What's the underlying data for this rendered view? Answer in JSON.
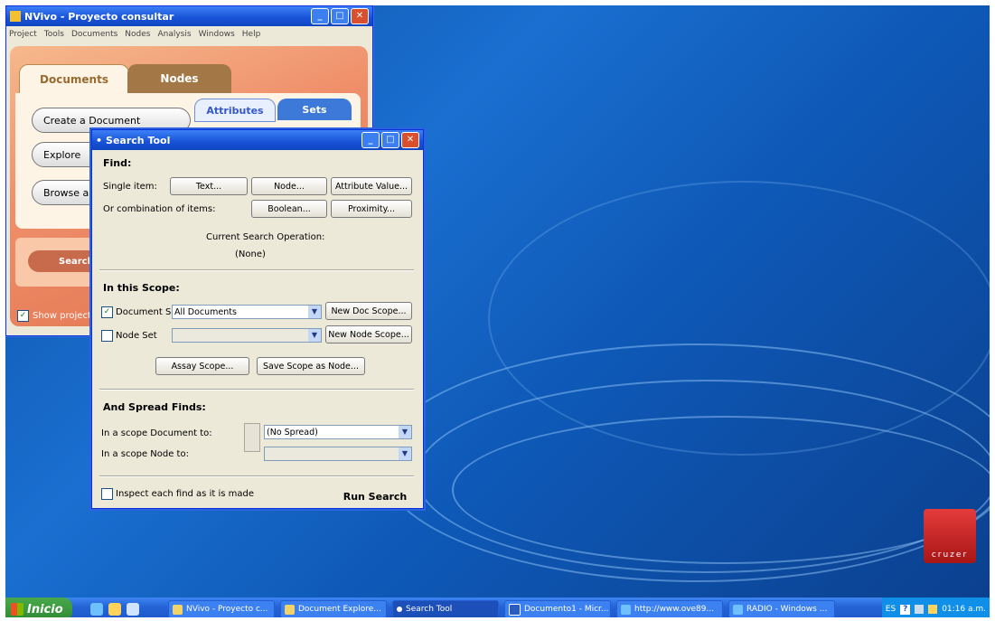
{
  "nvivo": {
    "title": "NVivo - Proyecto consultar",
    "menu": [
      "Project",
      "Tools",
      "Documents",
      "Nodes",
      "Analysis",
      "Windows",
      "Help"
    ],
    "tabs": [
      "Documents",
      "Nodes"
    ],
    "subtabs": [
      "Attributes",
      "Sets"
    ],
    "buttons": [
      "Create a Document",
      "Explore",
      "Browse a"
    ],
    "search_label": "Search",
    "show_project": "Show project"
  },
  "dialog": {
    "title": "Search Tool",
    "find_header": "Find:",
    "single_item_label": "Single item:",
    "text_btn": "Text...",
    "node_btn": "Node...",
    "attr_btn": "Attribute Value...",
    "combo_label": "Or combination of items:",
    "boolean_btn": "Boolean...",
    "proximity_btn": "Proximity...",
    "current_op_label": "Current Search Operation:",
    "current_op_value": "(None)",
    "scope_header": "In this Scope:",
    "doc_set_label": "Document Set",
    "doc_set_value": "All Documents",
    "new_doc_scope": "New Doc Scope...",
    "node_set_label": "Node Set",
    "node_set_value": "",
    "new_node_scope": "New Node Scope...",
    "assay_scope": "Assay Scope...",
    "save_scope": "Save Scope as Node...",
    "spread_header": "And Spread Finds:",
    "spread_doc_label": "In a scope Document to:",
    "spread_doc_value": "(No Spread)",
    "spread_node_label": "In a scope Node to:",
    "spread_node_value": "",
    "inspect_label": "Inspect each find as it is made",
    "run_search": "Run Search"
  },
  "taskbar": {
    "start": "Inicio",
    "tasks": [
      "NVivo - Proyecto c...",
      "Document Explore...",
      "Search Tool",
      "Documento1 - Micr...",
      "http://www.ove89...",
      "RADIO - Windows ..."
    ],
    "lang": "ES",
    "clock": "01:16 a.m."
  },
  "desktop": {
    "cruzer_label": "cruzer"
  }
}
